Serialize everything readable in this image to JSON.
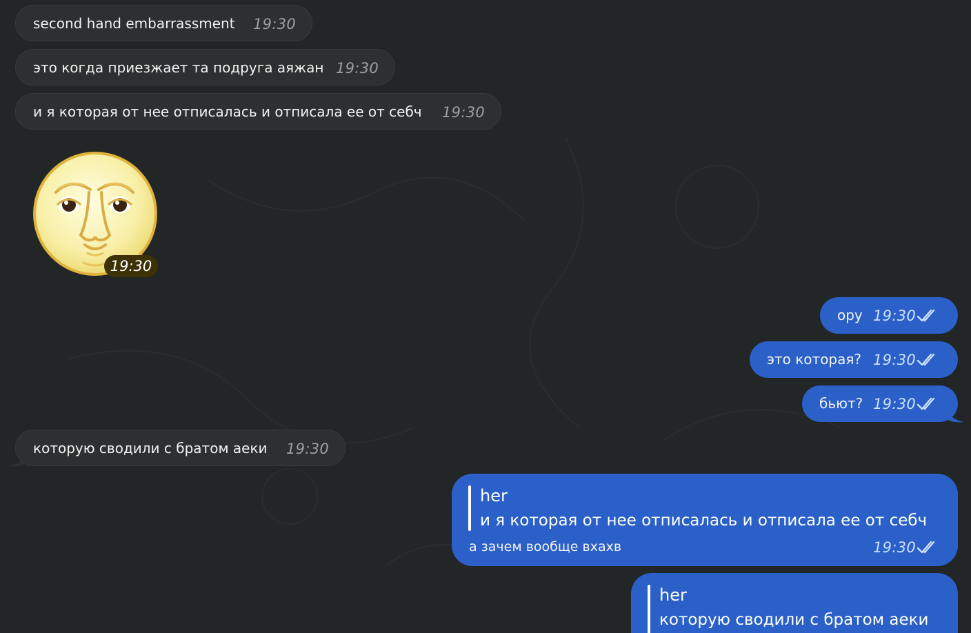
{
  "messages": [
    {
      "direction": "in",
      "text": "second hand embarrassment",
      "time": "19:30"
    },
    {
      "direction": "in",
      "text": "это когда приезжает та подруга аяжан",
      "time": "19:30"
    },
    {
      "direction": "in",
      "text": "и я которая от нее отписалась и отписала ее от себч",
      "time": "19:30"
    },
    {
      "direction": "in",
      "type": "sticker",
      "sticker": "full-moon-face",
      "time": "19:30"
    },
    {
      "direction": "out",
      "text": "ору",
      "time": "19:30",
      "status": "read"
    },
    {
      "direction": "out",
      "text": "это которая?",
      "time": "19:30",
      "status": "read"
    },
    {
      "direction": "out",
      "text": "бьют?",
      "time": "19:30",
      "status": "read"
    },
    {
      "direction": "in",
      "text": "которую сводили с братом аеки",
      "time": "19:30"
    },
    {
      "direction": "out",
      "reply_to": {
        "author": "her",
        "text": "и я которая от нее отписалась и отписала ее от себч"
      },
      "text": "а зачем вообще вхахв",
      "time": "19:30",
      "status": "read"
    },
    {
      "direction": "out",
      "reply_to": {
        "author": "her",
        "text": "которую сводили с братом аеки"
      }
    }
  ],
  "colors": {
    "background": "#232627",
    "incoming_bubble": "#2d2f30",
    "outgoing_bubble": "#2a60c7",
    "sticker_time_badge": "#3d3106"
  },
  "icons": {
    "read_status": "double-check-icon",
    "sticker": "full-moon-face"
  }
}
